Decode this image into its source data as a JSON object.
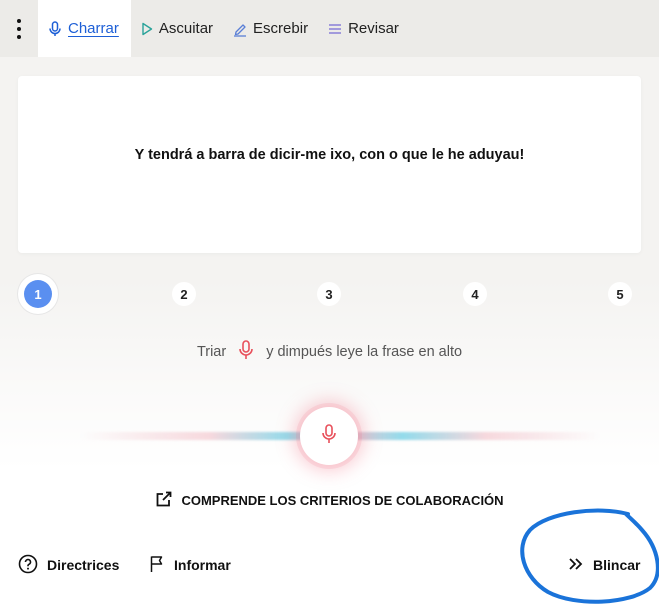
{
  "nav": {
    "tabs": [
      {
        "label": "Charrar",
        "icon": "microphone-icon",
        "active": true
      },
      {
        "label": "Ascuitar",
        "icon": "play-icon",
        "active": false
      },
      {
        "label": "Escrebir",
        "icon": "pencil-icon",
        "active": false
      },
      {
        "label": "Revisar",
        "icon": "list-icon",
        "active": false
      }
    ]
  },
  "card": {
    "sentence": "Y tendrá a barra de dicir-me ixo, con o que le he aduyau!"
  },
  "steps": [
    "1",
    "2",
    "3",
    "4",
    "5"
  ],
  "current_step": 1,
  "instruction": {
    "before": "Triar",
    "after": "y dimpués leye la frase en alto"
  },
  "criteria": {
    "label": "COMPRENDE LOS CRITERIOS DE COLABORACIÓN"
  },
  "footer": {
    "guidelines": "Directrices",
    "report": "Informar",
    "skip": "Blincar"
  },
  "colors": {
    "accent": "#1d5fd6",
    "step_active": "#5a8ff0",
    "mic_red": "#e8505b",
    "annotation_blue": "#1a73d9"
  }
}
